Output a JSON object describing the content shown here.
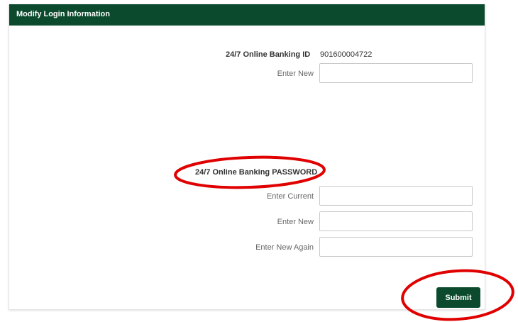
{
  "header": {
    "title": "Modify Login Information"
  },
  "banking_id": {
    "label": "24/7 Online Banking ID",
    "value": "901600004722",
    "enter_new_label": "Enter New",
    "enter_new_value": ""
  },
  "password": {
    "section_label": "24/7 Online Banking PASSWORD",
    "current_label": "Enter Current",
    "current_value": "",
    "new_label": "Enter New",
    "new_value": "",
    "new_again_label": "Enter New Again",
    "new_again_value": ""
  },
  "actions": {
    "submit_label": "Submit"
  },
  "colors": {
    "header_bg": "#0b4a2d",
    "button_bg": "#0b4a2d",
    "annotation": "#e00000"
  }
}
